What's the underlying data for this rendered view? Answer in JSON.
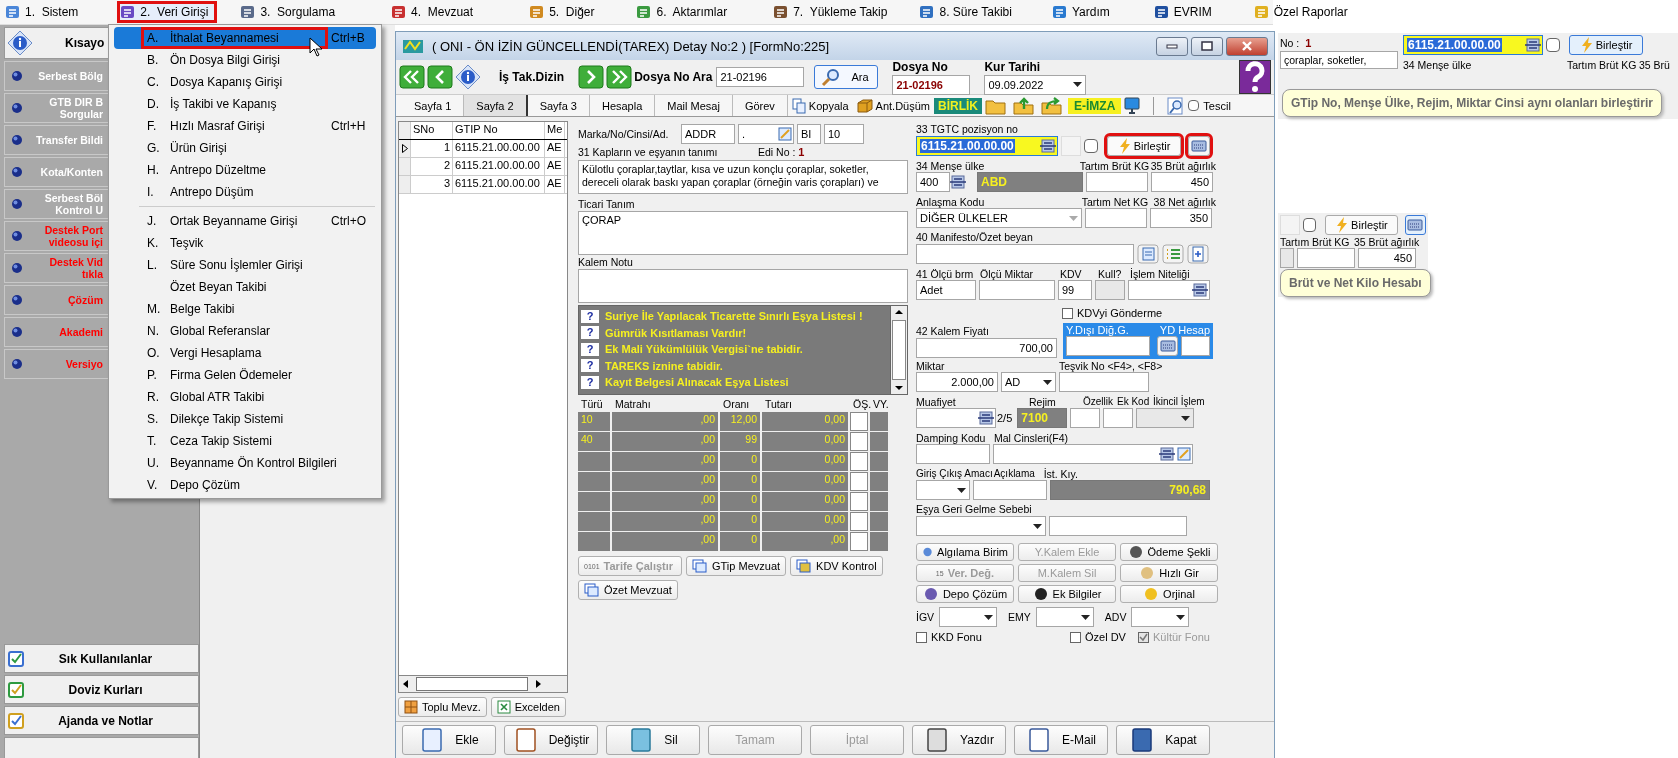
{
  "menu_bar": {
    "items": [
      {
        "label": "1.  Sistem",
        "selected": false,
        "highlighted": false
      },
      {
        "label": "2.  Veri Girişi",
        "selected": true,
        "highlighted": true
      },
      {
        "label": "3.  Sorgulama",
        "selected": false,
        "highlighted": false
      },
      {
        "label": "4.  Mevzuat",
        "selected": false,
        "highlighted": false
      },
      {
        "label": "5.  Diğer",
        "selected": false,
        "highlighted": false
      },
      {
        "label": "6.  Aktarımlar",
        "selected": false,
        "highlighted": false
      },
      {
        "label": "7.  Yükleme Takip",
        "selected": false,
        "highlighted": false
      },
      {
        "label": "8. Süre Takibi",
        "selected": false,
        "highlighted": false
      },
      {
        "label": "Yardım",
        "selected": false,
        "highlighted": false
      },
      {
        "label": "EVRIM",
        "selected": false,
        "highlighted": false
      },
      {
        "label": "Özel Raporlar",
        "selected": false,
        "highlighted": false
      }
    ]
  },
  "dropdown": {
    "groups": [
      [
        {
          "key": "A.",
          "label": "İthalat Beyannamesi",
          "shortcut": "Ctrl+B",
          "selected": true,
          "highlighted": true
        },
        {
          "key": "B.",
          "label": "Ön Dosya Bilgi Girişi",
          "selected": false,
          "highlighted": false
        },
        {
          "key": "C.",
          "label": "Dosya Kapanış Girişi",
          "selected": false,
          "highlighted": false
        },
        {
          "key": "D.",
          "label": "İş Takibi ve Kapanış",
          "selected": false,
          "highlighted": false
        },
        {
          "key": "F.",
          "label": "Hızlı Masraf Girişi",
          "shortcut": "Ctrl+H",
          "selected": false,
          "highlighted": false
        },
        {
          "key": "G.",
          "label": "Ürün Girişi",
          "selected": false,
          "highlighted": false
        },
        {
          "key": "H.",
          "label": "Antrepo Düzeltme",
          "selected": false,
          "highlighted": false
        },
        {
          "key": "I.",
          "label": "Antrepo Düşüm",
          "selected": false,
          "highlighted": false
        }
      ],
      [
        {
          "key": "J.",
          "label": "Ortak Beyanname Girişi",
          "shortcut": "Ctrl+O",
          "selected": false,
          "highlighted": false
        },
        {
          "key": "K.",
          "label": "Teşvik",
          "selected": false,
          "highlighted": false
        },
        {
          "key": "L.",
          "label": "Süre Sonu İşlemler Girişi",
          "selected": false,
          "highlighted": false
        },
        {
          "label": "Özet Beyan Takibi",
          "selected": false,
          "highlighted": false
        },
        {
          "key": "M.",
          "label": "Belge Takibi",
          "selected": false,
          "highlighted": false
        },
        {
          "key": "N.",
          "label": "Global Referanslar",
          "selected": false,
          "highlighted": false
        },
        {
          "key": "O.",
          "label": "Vergi Hesaplama",
          "selected": false,
          "highlighted": false
        },
        {
          "key": "P.",
          "label": "Firma Gelen Ödemeler",
          "selected": false,
          "highlighted": false
        },
        {
          "key": "R.",
          "label": "Global ATR Takibi",
          "selected": false,
          "highlighted": false
        },
        {
          "key": "S.",
          "label": "Dilekçe Takip Sistemi",
          "selected": false,
          "highlighted": false
        },
        {
          "key": "T.",
          "label": "Ceza Takip Sistemi",
          "selected": false,
          "highlighted": false
        },
        {
          "key": "U.",
          "label": "Beyanname Ön Kontrol Bilgileri",
          "selected": false,
          "highlighted": false
        },
        {
          "key": "V.",
          "label": "Depo Çözüm",
          "selected": false,
          "highlighted": false
        }
      ]
    ]
  },
  "sidebar": {
    "title": "Kısayo",
    "items": [
      {
        "label": "Serbest Bölg",
        "color": "#ffffff"
      },
      {
        "label": "GTB DIR B\nSorgular",
        "color": "#ffffff"
      },
      {
        "label": "Transfer Bildi",
        "color": "#ffffff"
      },
      {
        "label": "Kota/Konten",
        "color": "#ffffff"
      },
      {
        "label": "Serbest Böl\nKontrol U",
        "color": "#ffffff"
      },
      {
        "label": "Destek Port\nvideosu içi",
        "color": "#ff0000"
      },
      {
        "label": "Destek Vid\ntıkla",
        "color": "#ff0000"
      },
      {
        "label": "Çözüm",
        "color": "#ff0000"
      },
      {
        "label": "Akademi",
        "color": "#ff0000"
      },
      {
        "label": "Versiyo",
        "color": "#ff0000"
      }
    ],
    "shortcuts": [
      "Sık Kullanılanlar",
      "Doviz Kurları",
      "Ajanda ve Notlar"
    ]
  },
  "window": {
    "title": "( ONI - ÖN İZİN GÜNCELLENDİ(TAREX) Detay No:2 ) [FormNo:225]"
  },
  "toolbar": {
    "dizin_label": "İş Tak.Dizin",
    "search_label": "Dosya No Ara",
    "search_value": "21-02196",
    "search_button": "Ara",
    "dosya_no_label": "Dosya No",
    "dosya_no": "21-02196",
    "kur_tarihi_label": "Kur Tarihi",
    "kur_tarihi": "09.09.2022"
  },
  "tabs": [
    {
      "label": "Sayfa 1",
      "selected": false
    },
    {
      "label": "Sayfa 2",
      "selected": true
    },
    {
      "label": "Sayfa 3",
      "selected": false
    },
    {
      "label": "Hesapla",
      "selected": false
    },
    {
      "label": "Mail Mesaj",
      "selected": false
    },
    {
      "label": "Görev",
      "selected": false
    }
  ],
  "tab_tools": {
    "copy": "Kopyala",
    "ant_dusum": "Ant.Düşüm",
    "birlik": "BİRLİK",
    "eimza": "E-İMZA",
    "tescil": {
      "label": "Tescil",
      "checked": false
    }
  },
  "grid": {
    "columns": [
      "SNo",
      "GTIP No",
      "Me"
    ],
    "rows": [
      {
        "cells": [
          "1",
          "6115.21.00.00.00",
          "AE"
        ],
        "selected": true
      },
      {
        "cells": [
          "2",
          "6115.21.00.00.00",
          "AE"
        ],
        "selected": false
      },
      {
        "cells": [
          "3",
          "6115.21.00.00.00",
          "AE"
        ],
        "selected": false
      }
    ],
    "buttons": [
      "Toplu Mevz.",
      "Excelden"
    ]
  },
  "marka": {
    "label": "Marka/No/Cinsi/Ad.",
    "values": [
      "ADDR",
      ".",
      "BI",
      "10"
    ]
  },
  "description": {
    "label": "31 Kapların ve eşyanın tanımı",
    "edi_label": "Edi No :",
    "edi_no": "1",
    "lines": [
      "Külotlu çoraplar,taytlar, kısa ve uzun konçlu çoraplar, soketler,",
      "dereceli olarak baskı yapan çoraplar (örneğin varis çorapları) ve"
    ]
  },
  "ticari_tanim": {
    "label": "Ticari Tanım",
    "value": "ÇORAP"
  },
  "kalem_notu": {
    "label": "Kalem Notu"
  },
  "warnings": [
    {
      "icon": "?",
      "text": "Suriye İle Yapılacak Ticarette Sınırlı Eşya Listesi !"
    },
    {
      "icon": "?",
      "text": "Gümrük Kısıtlaması Vardır!"
    },
    {
      "icon": "?",
      "text": "Ek Mali Yükümlülük Vergisi`ne tabidir."
    },
    {
      "icon": "?",
      "text": "TAREKS iznine tabidir."
    },
    {
      "icon": "?",
      "text": "Kayıt Belgesi Alınacak Eşya Listesi"
    }
  ],
  "tax_table": {
    "columns": [
      "Türü",
      "Matrahı",
      "Oranı",
      "Tutarı",
      "ÖŞ.",
      "VY."
    ],
    "rows": [
      {
        "type": "10",
        "base": ",00",
        "rate": "12,00",
        "amount": "0,00"
      },
      {
        "type": "40",
        "base": ",00",
        "rate": "99",
        "amount": "0,00"
      },
      {
        "base": ",00",
        "rate": "0",
        "amount": "0,00"
      },
      {
        "base": ",00",
        "rate": "0",
        "amount": "0,00"
      },
      {
        "base": ",00",
        "rate": "0",
        "amount": "0,00"
      },
      {
        "base": ",00",
        "rate": "0",
        "amount": "0,00"
      },
      {
        "base": ",00",
        "rate": "0",
        "amount": ",00"
      }
    ]
  },
  "left_buttons": [
    {
      "label": "Tarife Çalıştır",
      "badge": "0101",
      "disabled": true
    },
    {
      "label": "GTip Mevzuat",
      "disabled": false
    },
    {
      "label": "KDV Kontrol",
      "disabled": false
    },
    {
      "label": "Özet Mevzuat",
      "disabled": false
    }
  ],
  "tgtc": {
    "label": "33 TGTC pozisyon no",
    "value": "6115.21.00.00.00",
    "checked": false,
    "merge_button": "Birleştir",
    "merge_highlighted": true,
    "calc_highlighted": true
  },
  "mense": {
    "label": "34 Menşe ülke",
    "code": "400",
    "name": "ABD"
  },
  "tartim_brut": {
    "label": "Tartım Brüt KG"
  },
  "brut": {
    "label": "35 Brüt ağırlık",
    "value": "450"
  },
  "anlasma": {
    "label": "Anlaşma Kodu",
    "value": "DİĞER ÜLKELER"
  },
  "tartim_net": {
    "label": "Tartım Net KG"
  },
  "net": {
    "label": "38 Net ağırlık",
    "value": "350"
  },
  "manifesto": {
    "label": "40 Manifesto/Özet beyan"
  },
  "olcu_brm": {
    "label": "41 Ölçü brm",
    "value": "Adet"
  },
  "olcu_miktar": {
    "label": "Ölçü Miktar"
  },
  "kdv": {
    "label": "KDV",
    "value": "99"
  },
  "kull": {
    "label": "Kull?"
  },
  "islem_niteligi": {
    "label": "İşlem Niteliği"
  },
  "kdv_gonderme": {
    "label": "KDVyi Gönderme",
    "checked": false
  },
  "kalem_fiyati": {
    "label": "42 Kalem Fiyatı",
    "value": "700,00"
  },
  "yd": {
    "label": "Y.Dışı Diğ.G.",
    "hesap_label": "YD Hesap"
  },
  "miktar": {
    "label": "Miktar",
    "value": "2.000,00",
    "unit": "AD"
  },
  "tesvik": {
    "label": "Teşvik No <F4>, <F8>"
  },
  "muafiyet": {
    "label": "Muafiyet",
    "count": "2/5"
  },
  "rejim": {
    "label": "Rejim",
    "value": "7100"
  },
  "ozellik": {
    "label": "Özellik"
  },
  "ek_kod": {
    "label": "Ek Kod"
  },
  "ikincil": {
    "label": "İkincil İşlem"
  },
  "damping": {
    "label": "Damping Kodu"
  },
  "mal_cinsleri": {
    "label": "Mal Cinsleri(F4)"
  },
  "giris_cikis": {
    "label": "Giriş Çıkış Amacı"
  },
  "aciklama": {
    "label": "Açıklama"
  },
  "ist_kiy": {
    "label": "İst. Kıy.",
    "value": "790,68"
  },
  "esya_geri": {
    "label": "Eşya Geri Gelme Sebebi"
  },
  "action_buttons": [
    {
      "label": "Algılama Birim",
      "disabled": false
    },
    {
      "label": "Y.Kalem Ekle",
      "disabled": true
    },
    {
      "label": "Ödeme Şekli",
      "disabled": false
    },
    {
      "label": "Ver. Değ.",
      "badge": "15",
      "disabled": true
    },
    {
      "label": "M.Kalem Sil",
      "disabled": true
    },
    {
      "label": "Hızlı Gir",
      "disabled": false
    },
    {
      "label": "Depo Çözüm",
      "disabled": false
    },
    {
      "label": "Ek Bilgiler",
      "disabled": false
    },
    {
      "label": "Orjinal",
      "disabled": false
    }
  ],
  "duty_selects": [
    "İGV",
    "EMY",
    "ADV"
  ],
  "fund_checks": [
    {
      "label": "KKD Fonu",
      "checked": false,
      "disabled": false
    },
    {
      "label": "Özel DV",
      "checked": false,
      "disabled": false
    },
    {
      "label": "Kültür Fonu",
      "checked": true,
      "disabled": true
    }
  ],
  "bottom_buttons": [
    {
      "label": "Ekle",
      "disabled": false
    },
    {
      "label": "Değiştir",
      "disabled": false
    },
    {
      "label": "Sil",
      "disabled": false
    },
    {
      "label": "Tamam",
      "disabled": true
    },
    {
      "label": "İptal",
      "disabled": true
    },
    {
      "label": "Yazdır",
      "disabled": false
    },
    {
      "label": "E-Mail",
      "disabled": false
    },
    {
      "label": "Kapat",
      "disabled": false
    }
  ],
  "callout_merge": {
    "edi_label": "No :",
    "edi_no": "1",
    "text_fragment": "çoraplar, soketler,",
    "tgtc_value": "6115.21.00.00.00",
    "checked": false,
    "button": "Birleştir",
    "mense_label": "34 Menşe ülke",
    "tartim_label": "Tartım Brüt KG",
    "brut_label": "35 Brü",
    "tooltip": "GTip No, Menşe Ülke, Rejim, Miktar Cinsi aynı olanları birleştirir"
  },
  "callout_weight": {
    "checked": false,
    "button": "Birleştir",
    "tartim_label": "Tartım Brüt KG",
    "brut_label": "35 Brüt ağırlık",
    "value": "450",
    "tooltip": "Brüt ve Net Kilo Hesabı"
  }
}
